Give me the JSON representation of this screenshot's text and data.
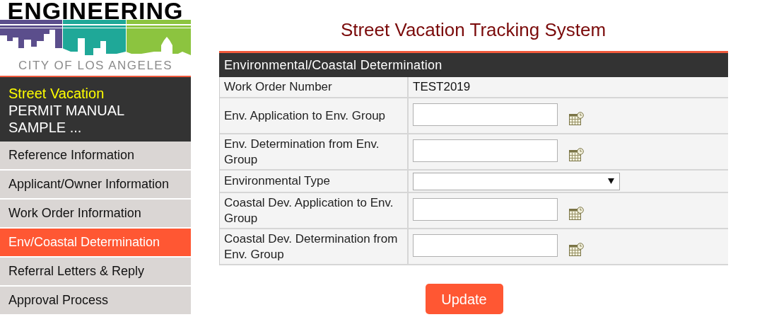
{
  "logo": {
    "title": "ENGINEERING",
    "subtitle": "CITY OF LOS ANGELES"
  },
  "sidebar": {
    "heading": "Street Vacation",
    "subheading": "PERMIT MANUAL SAMPLE ...",
    "items": [
      {
        "label": "Reference Information",
        "selected": false
      },
      {
        "label": "Applicant/Owner Information",
        "selected": false
      },
      {
        "label": "Work Order Information",
        "selected": false
      },
      {
        "label": "Env/Coastal Determination",
        "selected": true
      },
      {
        "label": "Referral Letters & Reply",
        "selected": false
      },
      {
        "label": "Approval Process",
        "selected": false
      }
    ]
  },
  "page_title": "Street Vacation Tracking System",
  "form": {
    "title": "Environmental/Coastal Determination",
    "rows": [
      {
        "kind": "text",
        "label": "Work Order Number",
        "value": "TEST2019"
      },
      {
        "kind": "date",
        "label": "Env. Application to Env. Group"
      },
      {
        "kind": "date",
        "label": "Env. Determination from Env. Group"
      },
      {
        "kind": "select",
        "label": "Environmental Type"
      },
      {
        "kind": "date",
        "label": "Coastal Dev. Application to Env. Group"
      },
      {
        "kind": "date",
        "label": "Coastal Dev. Determination from Env. Group"
      }
    ]
  },
  "buttons": [
    "Update"
  ]
}
